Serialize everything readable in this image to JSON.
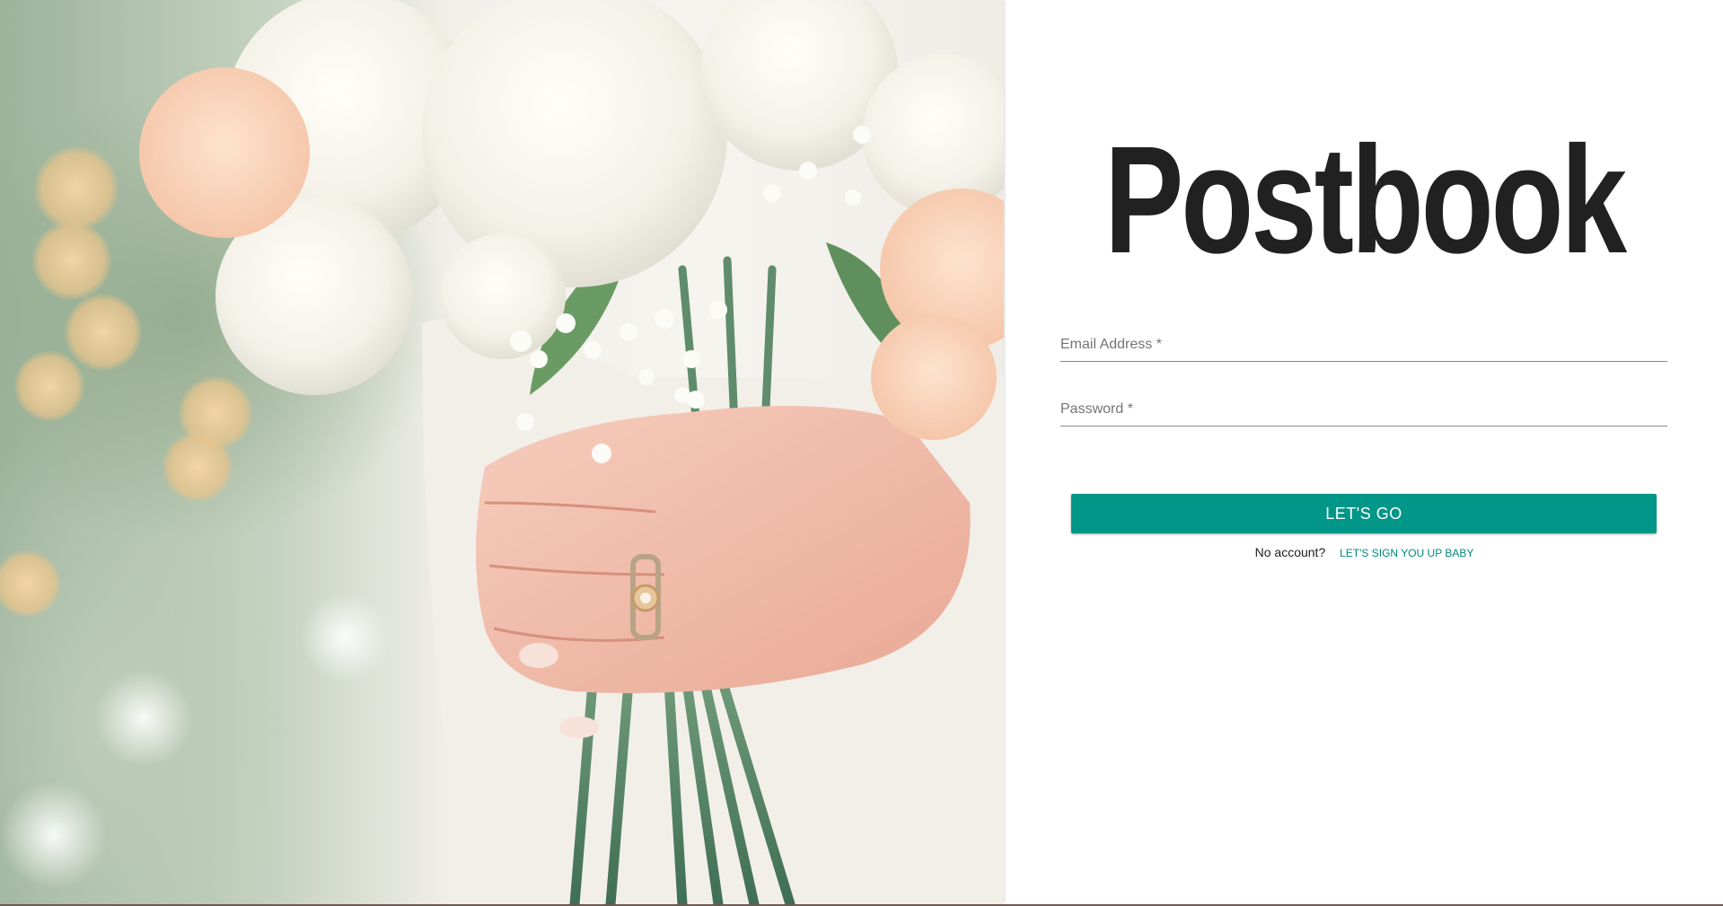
{
  "brand": {
    "title": "Postbook"
  },
  "hero": {
    "image_icon": "bouquet-with-ring-photo"
  },
  "form": {
    "email": {
      "label": "Email Address *",
      "value": ""
    },
    "password": {
      "label": "Password *",
      "value": ""
    },
    "submit_label": "LET'S GO",
    "no_account_text": "No account?",
    "signup_link_label": "LET'S SIGN YOU UP BABY"
  },
  "colors": {
    "accent": "#009688",
    "link": "#00897b",
    "title": "#212121"
  }
}
